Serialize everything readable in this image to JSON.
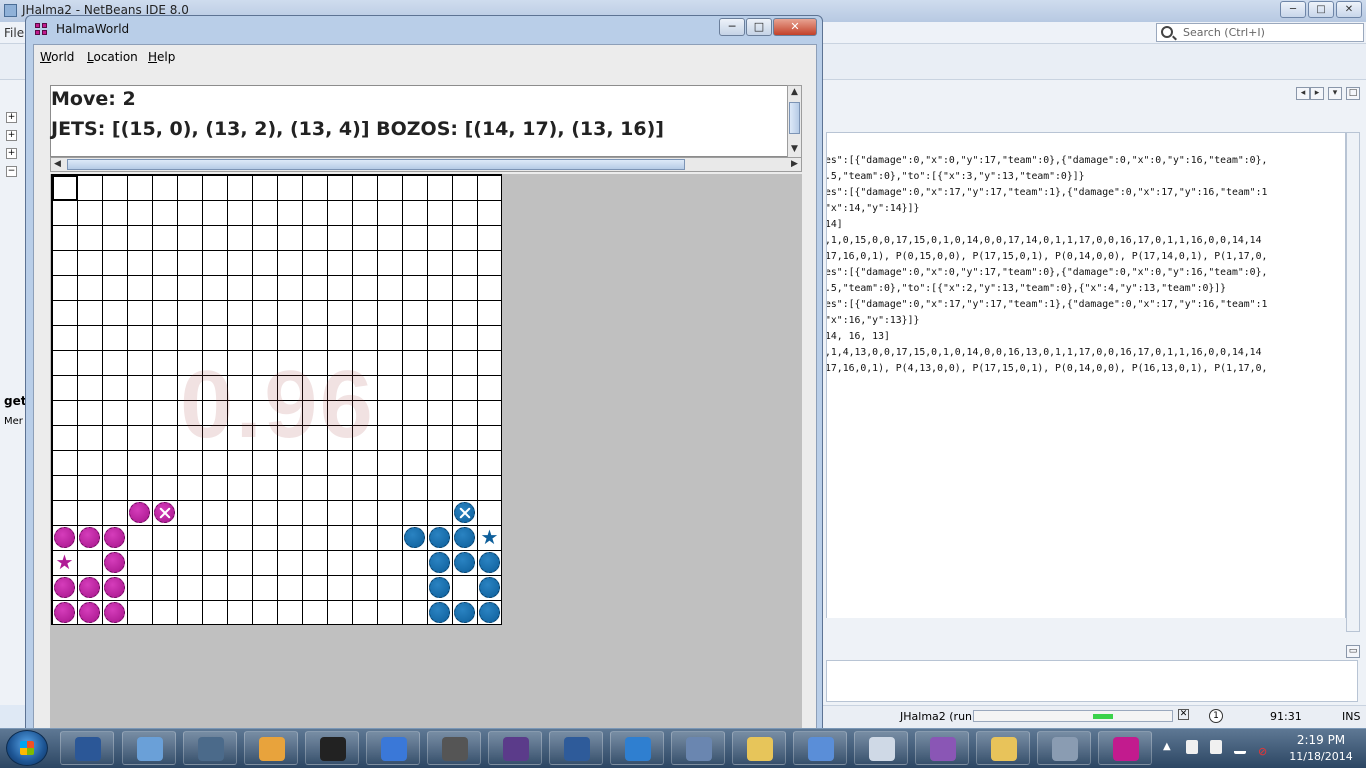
{
  "ide": {
    "title": "JHalma2 - NetBeans IDE 8.0",
    "menu_first": "File",
    "search_placeholder": "Search (Ctrl+I)",
    "editor_lines": [
      "es\":[{\"damage\":0,\"x\":0,\"y\":17,\"team\":0},{\"damage\":0,\"x\":0,\"y\":16,\"team\":0},",
      ".5,\"team\":0},\"to\":[{\"x\":3,\"y\":13,\"team\":0}]}",
      "es\":[{\"damage\":0,\"x\":17,\"y\":17,\"team\":1},{\"damage\":0,\"x\":17,\"y\":16,\"team\":1",
      "\"x\":14,\"y\":14}]}",
      " 14]",
      ",1,0,15,0,0,17,15,0,1,0,14,0,0,17,14,0,1,1,17,0,0,16,17,0,1,1,16,0,0,14,14",
      "17,16,0,1), P(0,15,0,0), P(17,15,0,1), P(0,14,0,0), P(17,14,0,1), P(1,17,0,",
      "es\":[{\"damage\":0,\"x\":0,\"y\":17,\"team\":0},{\"damage\":0,\"x\":0,\"y\":16,\"team\":0},",
      ".5,\"team\":0},\"to\":[{\"x\":2,\"y\":13,\"team\":0},{\"x\":4,\"y\":13,\"team\":0}]}",
      "es\":[{\"damage\":0,\"x\":17,\"y\":17,\"team\":1},{\"damage\":0,\"x\":17,\"y\":16,\"team\":1",
      "\"x\":16,\"y\":13}]}",
      "14, 16, 13]",
      ",1,4,13,0,0,17,15,0,1,0,14,0,0,16,13,0,1,1,17,0,0,16,17,0,1,1,16,0,0,14,14",
      "17,16,0,1), P(4,13,0,0), P(17,15,0,1), P(0,14,0,0), P(16,13,0,1), P(1,17,0,"
    ],
    "left_tab": "get",
    "left_tab2": "Mer",
    "status": {
      "run_label": "JHalma2 (run)",
      "progress": 0.65,
      "cursor": "91:31",
      "mode": "INS"
    }
  },
  "halma": {
    "title": "HalmaWorld",
    "menus": [
      "World",
      "Location",
      "Help"
    ],
    "move_line": "Move: 2",
    "teams_line": "JETS: [(15, 0), (13, 2), (13, 4)]  BOZOS: [(14, 17), (13, 16)]",
    "watermark": "0.96",
    "grid_cols": 18,
    "grid_rows": 18,
    "pieces": [
      {
        "team": "jets",
        "col": 3,
        "row": 13,
        "kind": "dot"
      },
      {
        "team": "jets",
        "col": 4,
        "row": 13,
        "kind": "cross"
      },
      {
        "team": "jets",
        "col": 0,
        "row": 14,
        "kind": "dot"
      },
      {
        "team": "jets",
        "col": 1,
        "row": 14,
        "kind": "dot"
      },
      {
        "team": "jets",
        "col": 2,
        "row": 14,
        "kind": "dot"
      },
      {
        "team": "jets",
        "col": 0,
        "row": 15,
        "kind": "star"
      },
      {
        "team": "jets",
        "col": 2,
        "row": 15,
        "kind": "dot"
      },
      {
        "team": "jets",
        "col": 0,
        "row": 16,
        "kind": "dot"
      },
      {
        "team": "jets",
        "col": 1,
        "row": 16,
        "kind": "dot"
      },
      {
        "team": "jets",
        "col": 2,
        "row": 16,
        "kind": "dot"
      },
      {
        "team": "jets",
        "col": 0,
        "row": 17,
        "kind": "dot"
      },
      {
        "team": "jets",
        "col": 1,
        "row": 17,
        "kind": "dot"
      },
      {
        "team": "jets",
        "col": 2,
        "row": 17,
        "kind": "dot"
      },
      {
        "team": "bozos",
        "col": 16,
        "row": 13,
        "kind": "cross"
      },
      {
        "team": "bozos",
        "col": 14,
        "row": 14,
        "kind": "dot"
      },
      {
        "team": "bozos",
        "col": 15,
        "row": 14,
        "kind": "dot"
      },
      {
        "team": "bozos",
        "col": 16,
        "row": 14,
        "kind": "dot"
      },
      {
        "team": "bozos",
        "col": 17,
        "row": 14,
        "kind": "star"
      },
      {
        "team": "bozos",
        "col": 15,
        "row": 15,
        "kind": "dot"
      },
      {
        "team": "bozos",
        "col": 16,
        "row": 15,
        "kind": "dot"
      },
      {
        "team": "bozos",
        "col": 17,
        "row": 15,
        "kind": "dot"
      },
      {
        "team": "bozos",
        "col": 15,
        "row": 16,
        "kind": "dot"
      },
      {
        "team": "bozos",
        "col": 17,
        "row": 16,
        "kind": "dot"
      },
      {
        "team": "bozos",
        "col": 15,
        "row": 17,
        "kind": "dot"
      },
      {
        "team": "bozos",
        "col": 16,
        "row": 17,
        "kind": "dot"
      },
      {
        "team": "bozos",
        "col": 17,
        "row": 17,
        "kind": "dot"
      }
    ],
    "colors": {
      "jets": "#b01b96",
      "bozos": "#0e5f9b"
    }
  },
  "taskbar": {
    "apps": [
      "word-icon",
      "remote-desktop-icon",
      "network-lock-icon",
      "chrome-icon",
      "cmd-icon",
      "butterfly-icon",
      "sublime-icon",
      "eclipse-icon",
      "netbeans-icon",
      "wireshark-icon",
      "network-admin-icon",
      "java-app-icon",
      "virtualbox-icon",
      "cube-app-icon",
      "cat-app-icon",
      "explorer-icon",
      "paint-icon",
      "halma-app-icon"
    ],
    "time": "2:19 PM",
    "date": "11/18/2014"
  }
}
